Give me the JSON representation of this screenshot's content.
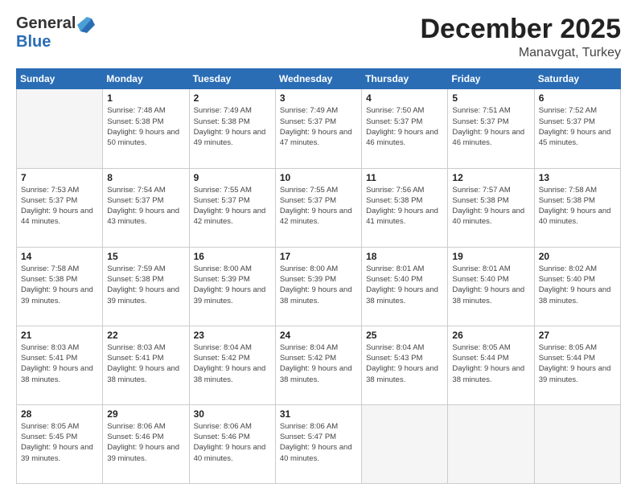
{
  "logo": {
    "line1": "General",
    "line2": "Blue"
  },
  "header": {
    "title": "December 2025",
    "subtitle": "Manavgat, Turkey"
  },
  "days_of_week": [
    "Sunday",
    "Monday",
    "Tuesday",
    "Wednesday",
    "Thursday",
    "Friday",
    "Saturday"
  ],
  "weeks": [
    [
      {
        "day": "",
        "empty": true
      },
      {
        "day": "1",
        "sunrise": "Sunrise: 7:48 AM",
        "sunset": "Sunset: 5:38 PM",
        "daylight": "Daylight: 9 hours and 50 minutes."
      },
      {
        "day": "2",
        "sunrise": "Sunrise: 7:49 AM",
        "sunset": "Sunset: 5:38 PM",
        "daylight": "Daylight: 9 hours and 49 minutes."
      },
      {
        "day": "3",
        "sunrise": "Sunrise: 7:49 AM",
        "sunset": "Sunset: 5:37 PM",
        "daylight": "Daylight: 9 hours and 47 minutes."
      },
      {
        "day": "4",
        "sunrise": "Sunrise: 7:50 AM",
        "sunset": "Sunset: 5:37 PM",
        "daylight": "Daylight: 9 hours and 46 minutes."
      },
      {
        "day": "5",
        "sunrise": "Sunrise: 7:51 AM",
        "sunset": "Sunset: 5:37 PM",
        "daylight": "Daylight: 9 hours and 46 minutes."
      },
      {
        "day": "6",
        "sunrise": "Sunrise: 7:52 AM",
        "sunset": "Sunset: 5:37 PM",
        "daylight": "Daylight: 9 hours and 45 minutes."
      }
    ],
    [
      {
        "day": "7",
        "sunrise": "Sunrise: 7:53 AM",
        "sunset": "Sunset: 5:37 PM",
        "daylight": "Daylight: 9 hours and 44 minutes."
      },
      {
        "day": "8",
        "sunrise": "Sunrise: 7:54 AM",
        "sunset": "Sunset: 5:37 PM",
        "daylight": "Daylight: 9 hours and 43 minutes."
      },
      {
        "day": "9",
        "sunrise": "Sunrise: 7:55 AM",
        "sunset": "Sunset: 5:37 PM",
        "daylight": "Daylight: 9 hours and 42 minutes."
      },
      {
        "day": "10",
        "sunrise": "Sunrise: 7:55 AM",
        "sunset": "Sunset: 5:37 PM",
        "daylight": "Daylight: 9 hours and 42 minutes."
      },
      {
        "day": "11",
        "sunrise": "Sunrise: 7:56 AM",
        "sunset": "Sunset: 5:38 PM",
        "daylight": "Daylight: 9 hours and 41 minutes."
      },
      {
        "day": "12",
        "sunrise": "Sunrise: 7:57 AM",
        "sunset": "Sunset: 5:38 PM",
        "daylight": "Daylight: 9 hours and 40 minutes."
      },
      {
        "day": "13",
        "sunrise": "Sunrise: 7:58 AM",
        "sunset": "Sunset: 5:38 PM",
        "daylight": "Daylight: 9 hours and 40 minutes."
      }
    ],
    [
      {
        "day": "14",
        "sunrise": "Sunrise: 7:58 AM",
        "sunset": "Sunset: 5:38 PM",
        "daylight": "Daylight: 9 hours and 39 minutes."
      },
      {
        "day": "15",
        "sunrise": "Sunrise: 7:59 AM",
        "sunset": "Sunset: 5:38 PM",
        "daylight": "Daylight: 9 hours and 39 minutes."
      },
      {
        "day": "16",
        "sunrise": "Sunrise: 8:00 AM",
        "sunset": "Sunset: 5:39 PM",
        "daylight": "Daylight: 9 hours and 39 minutes."
      },
      {
        "day": "17",
        "sunrise": "Sunrise: 8:00 AM",
        "sunset": "Sunset: 5:39 PM",
        "daylight": "Daylight: 9 hours and 38 minutes."
      },
      {
        "day": "18",
        "sunrise": "Sunrise: 8:01 AM",
        "sunset": "Sunset: 5:40 PM",
        "daylight": "Daylight: 9 hours and 38 minutes."
      },
      {
        "day": "19",
        "sunrise": "Sunrise: 8:01 AM",
        "sunset": "Sunset: 5:40 PM",
        "daylight": "Daylight: 9 hours and 38 minutes."
      },
      {
        "day": "20",
        "sunrise": "Sunrise: 8:02 AM",
        "sunset": "Sunset: 5:40 PM",
        "daylight": "Daylight: 9 hours and 38 minutes."
      }
    ],
    [
      {
        "day": "21",
        "sunrise": "Sunrise: 8:03 AM",
        "sunset": "Sunset: 5:41 PM",
        "daylight": "Daylight: 9 hours and 38 minutes."
      },
      {
        "day": "22",
        "sunrise": "Sunrise: 8:03 AM",
        "sunset": "Sunset: 5:41 PM",
        "daylight": "Daylight: 9 hours and 38 minutes."
      },
      {
        "day": "23",
        "sunrise": "Sunrise: 8:04 AM",
        "sunset": "Sunset: 5:42 PM",
        "daylight": "Daylight: 9 hours and 38 minutes."
      },
      {
        "day": "24",
        "sunrise": "Sunrise: 8:04 AM",
        "sunset": "Sunset: 5:42 PM",
        "daylight": "Daylight: 9 hours and 38 minutes."
      },
      {
        "day": "25",
        "sunrise": "Sunrise: 8:04 AM",
        "sunset": "Sunset: 5:43 PM",
        "daylight": "Daylight: 9 hours and 38 minutes."
      },
      {
        "day": "26",
        "sunrise": "Sunrise: 8:05 AM",
        "sunset": "Sunset: 5:44 PM",
        "daylight": "Daylight: 9 hours and 38 minutes."
      },
      {
        "day": "27",
        "sunrise": "Sunrise: 8:05 AM",
        "sunset": "Sunset: 5:44 PM",
        "daylight": "Daylight: 9 hours and 39 minutes."
      }
    ],
    [
      {
        "day": "28",
        "sunrise": "Sunrise: 8:05 AM",
        "sunset": "Sunset: 5:45 PM",
        "daylight": "Daylight: 9 hours and 39 minutes."
      },
      {
        "day": "29",
        "sunrise": "Sunrise: 8:06 AM",
        "sunset": "Sunset: 5:46 PM",
        "daylight": "Daylight: 9 hours and 39 minutes."
      },
      {
        "day": "30",
        "sunrise": "Sunrise: 8:06 AM",
        "sunset": "Sunset: 5:46 PM",
        "daylight": "Daylight: 9 hours and 40 minutes."
      },
      {
        "day": "31",
        "sunrise": "Sunrise: 8:06 AM",
        "sunset": "Sunset: 5:47 PM",
        "daylight": "Daylight: 9 hours and 40 minutes."
      },
      {
        "day": "",
        "empty": true
      },
      {
        "day": "",
        "empty": true
      },
      {
        "day": "",
        "empty": true
      }
    ]
  ]
}
